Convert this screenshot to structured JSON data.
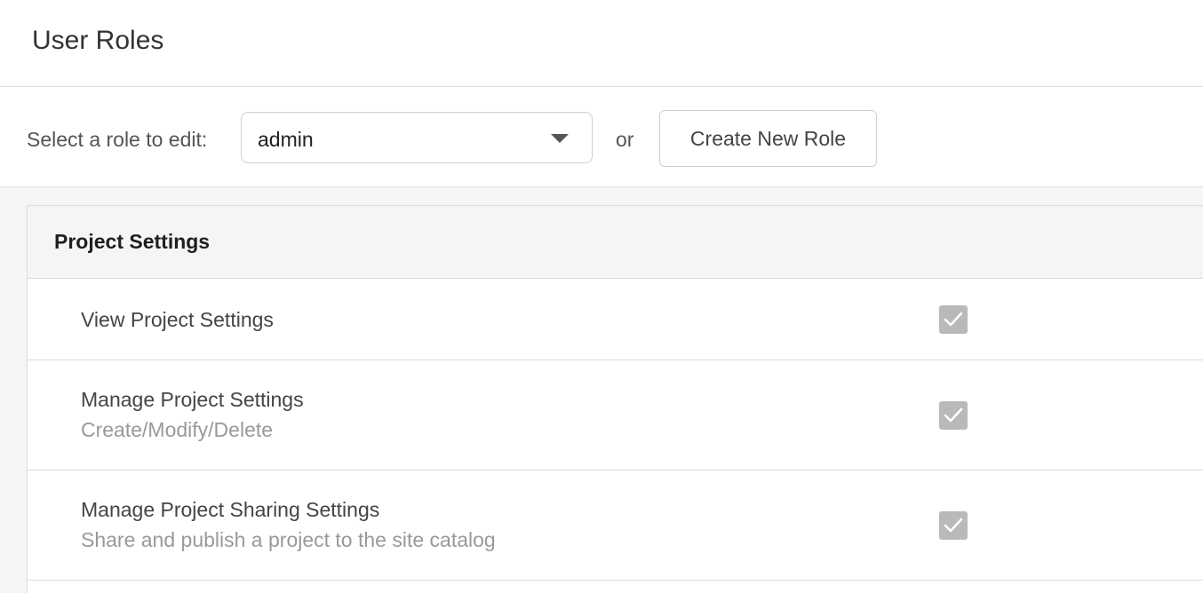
{
  "header": {
    "title": "User Roles"
  },
  "toolbar": {
    "select_label": "Select a role to edit:",
    "role_select_value": "admin",
    "or_text": "or",
    "create_button_label": "Create New Role"
  },
  "section": {
    "title": "Project Settings",
    "permissions": [
      {
        "title": "View Project Settings",
        "description": "",
        "checked": true,
        "checkbox_icon": "checkmark-icon"
      },
      {
        "title": "Manage Project Settings",
        "description": "Create/Modify/Delete",
        "checked": true,
        "checkbox_icon": "checkmark-icon"
      },
      {
        "title": "Manage Project Sharing Settings",
        "description": "Share and publish a project to the site catalog",
        "checked": true,
        "checkbox_icon": "checkmark-icon"
      }
    ]
  },
  "colors": {
    "checkbox_disabled": "#b9b9b9",
    "section_header_bg": "#f4f5f7",
    "border": "#dcdcdc",
    "muted_text": "#999999"
  }
}
